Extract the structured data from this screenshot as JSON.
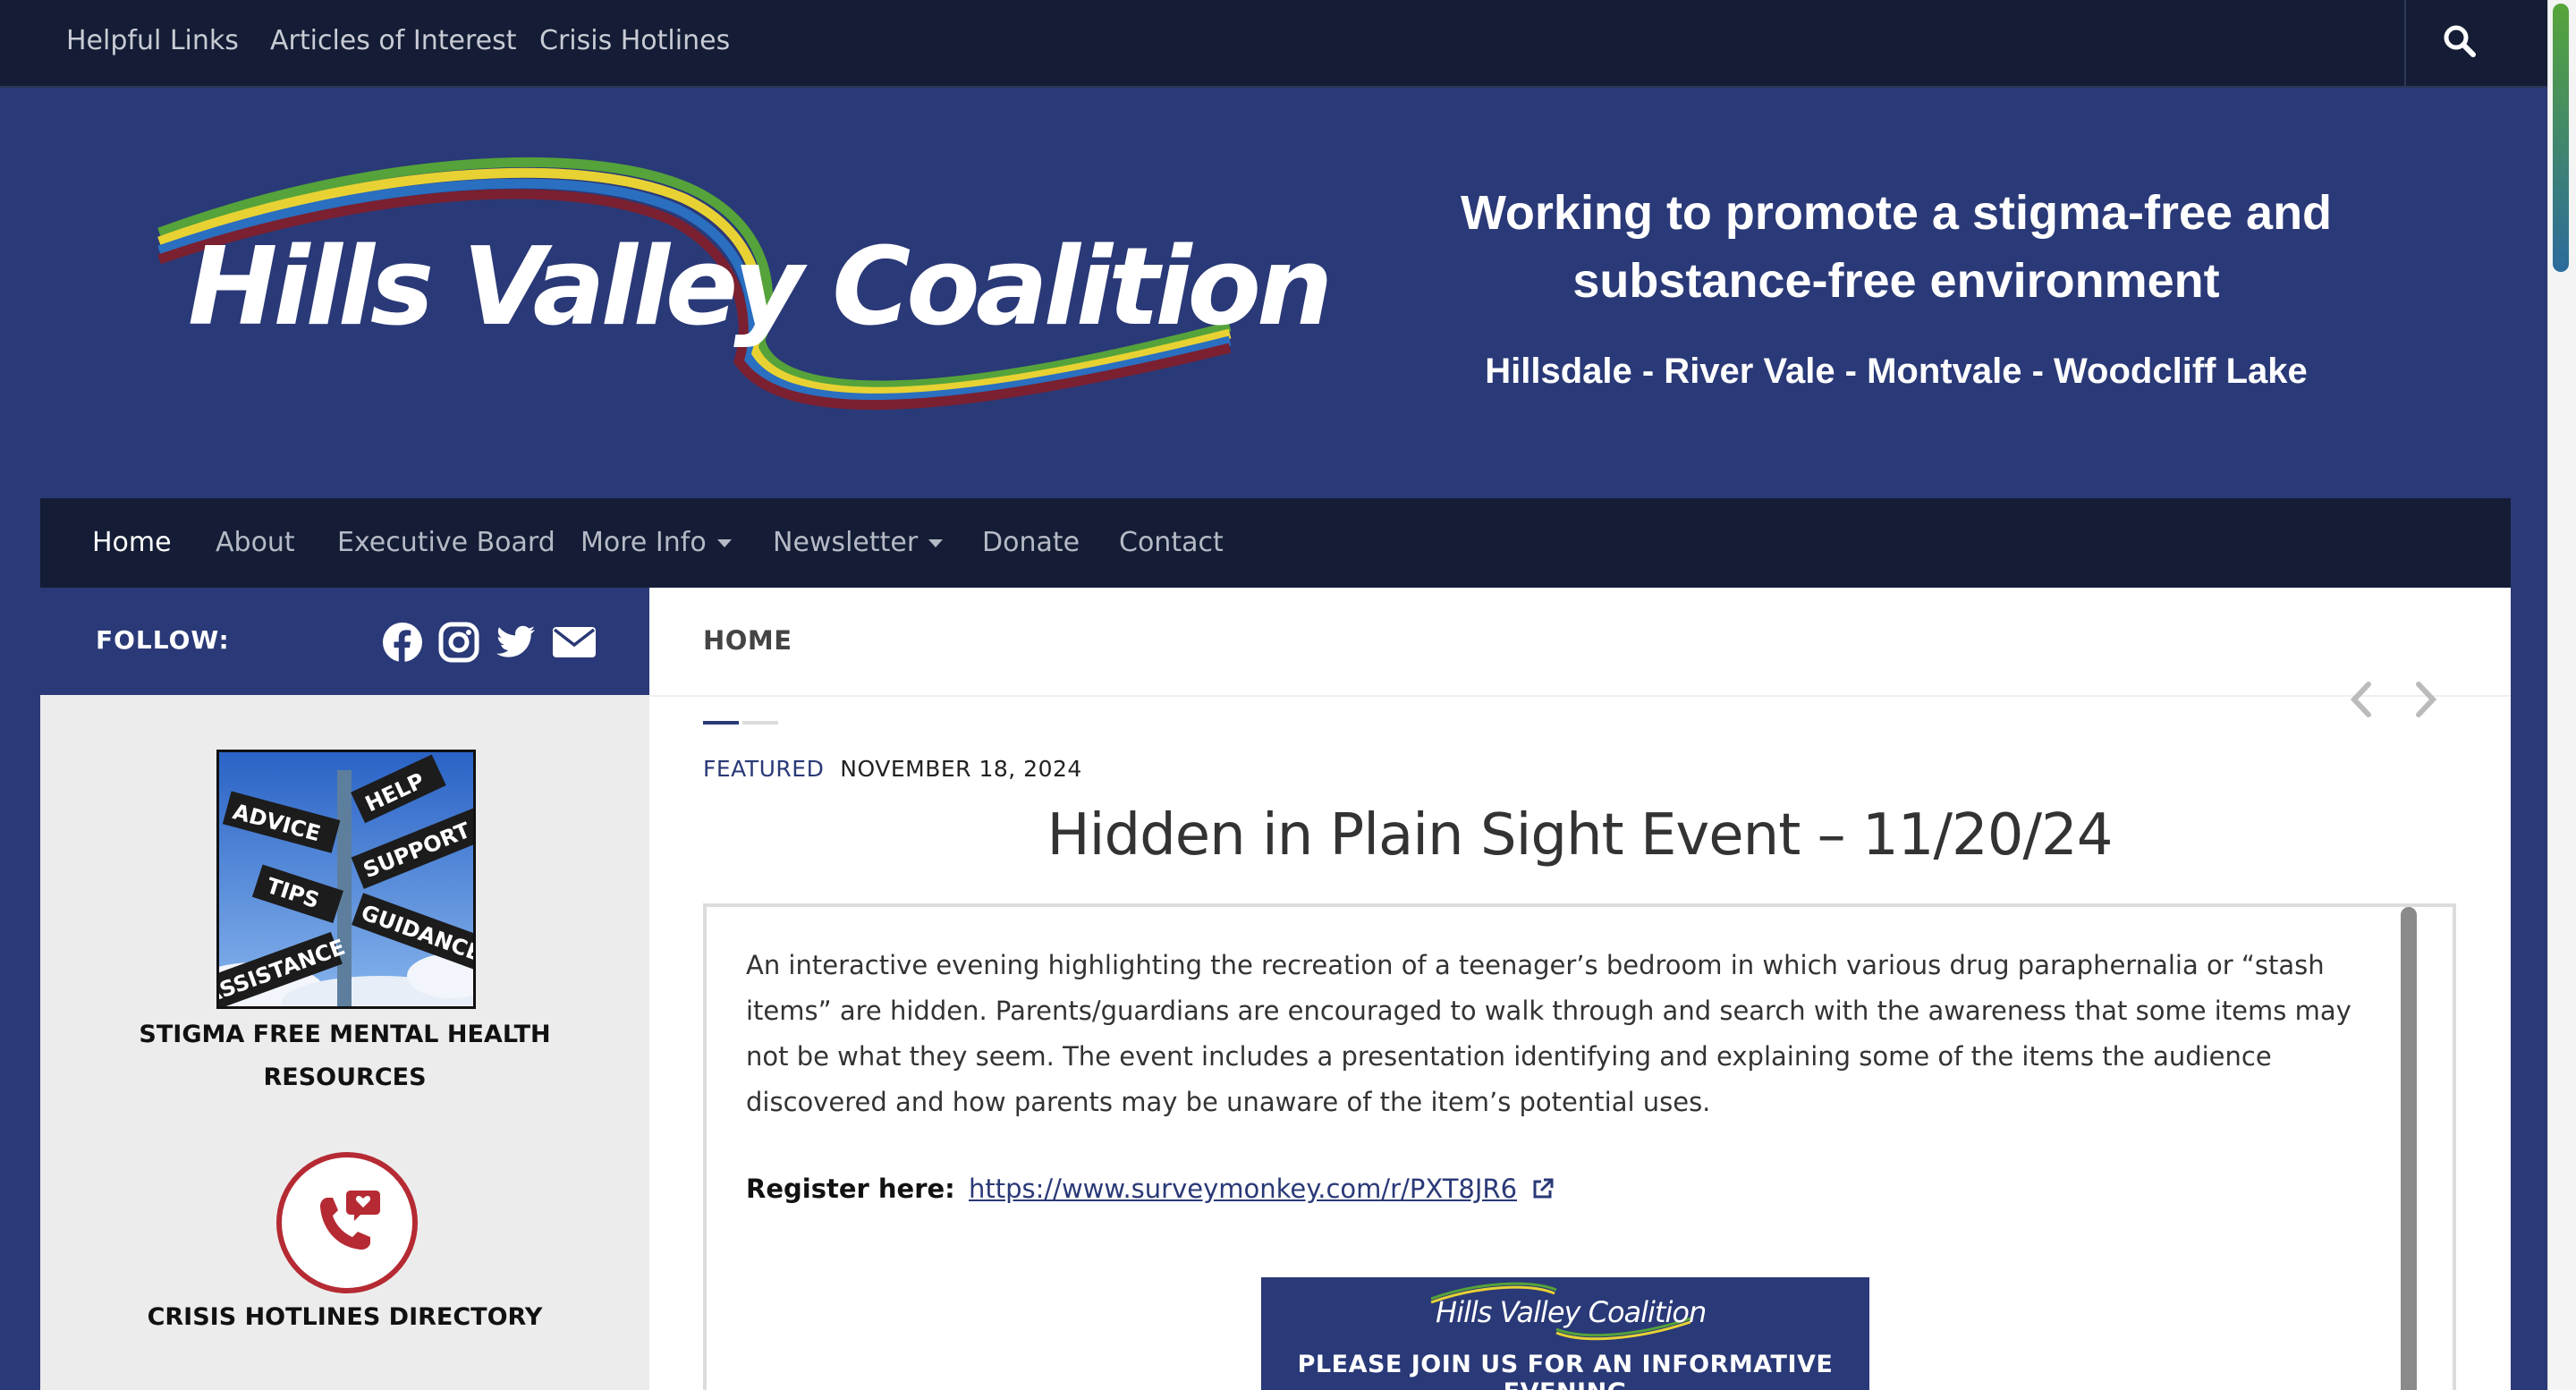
{
  "topbar": {
    "links": [
      "Helpful Links",
      "Articles of Interest",
      "Crisis Hotlines"
    ]
  },
  "header": {
    "logo_text": "Hills Valley Coalition",
    "tagline_line1": "Working to promote a stigma-free and",
    "tagline_line2": "substance-free environment",
    "towns": "Hillsdale - River Vale - Montvale - Woodcliff Lake"
  },
  "nav": {
    "items": [
      "Home",
      "About",
      "Executive Board",
      "More Info",
      "Newsletter",
      "Donate",
      "Contact"
    ]
  },
  "sidebar": {
    "follow_label": "FOLLOW:",
    "social_icons": [
      "facebook-icon",
      "instagram-icon",
      "twitter-icon",
      "envelope-icon"
    ],
    "widget1_sign_words": [
      "ADVICE",
      "HELP",
      "SUPPORT",
      "TIPS",
      "GUIDANCE",
      "ASSISTANCE"
    ],
    "widget1_title_line1": "STIGMA FREE MENTAL HEALTH",
    "widget1_title_line2": "RESOURCES",
    "widget2_title": "CRISIS HOTLINES DIRECTORY"
  },
  "content": {
    "breadcrumb": "HOME",
    "category": "FEATURED",
    "date": "NOVEMBER 18, 2024",
    "title": "Hidden in Plain Sight Event – 11/20/24",
    "body": "An interactive evening highlighting the recreation of a teenager’s bedroom in which various drug paraphernalia or “stash items” are hidden. Parents/guardians are encouraged to walk through and search with the awareness that some items may not be what they seem. The event includes a presentation identifying and explaining some of the items the audience discovered and how parents may be unaware of the item’s potential uses.",
    "register_label": "Register here:",
    "register_link": "https://www.surveymonkey.com/r/PXT8JR6",
    "flyer_logo": "Hills Valley Coalition",
    "flyer_subtitle": "PLEASE JOIN US FOR AN INFORMATIVE EVENING"
  },
  "colors": {
    "brand_navy": "#2a3977",
    "dark_nav": "#141d35",
    "crisis_red": "#b52a33"
  }
}
